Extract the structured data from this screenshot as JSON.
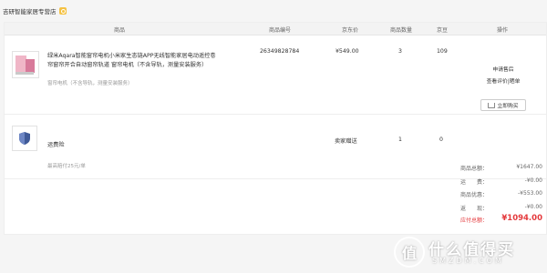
{
  "shop": {
    "name": "吉研智能家居专营店"
  },
  "table": {
    "headers": [
      "商品",
      "商品编号",
      "京东价",
      "商品数量",
      "京豆",
      "操作"
    ]
  },
  "product": {
    "title": "绿米Aqara智能窗帘电机小米家生态链APP无线智能家居电动遥控卷帘窗帘开合自动窗帘轨道 窗帘电机（不含导轨，测量安装服务）",
    "attr": "窗帘电机（不含导轨，测量安装服务）",
    "sku": "26349828784",
    "price": "¥549.00",
    "qty": "3",
    "beans": "109",
    "ops": {
      "apply_aftersale": "申请售后",
      "review": "查看评价|晒单",
      "repurchase": "立即购买"
    }
  },
  "service": {
    "name": "运费险",
    "price_label": "卖家赠送",
    "qty": "1",
    "beans": "0",
    "desc": "最高赔付25元/单"
  },
  "summary": [
    {
      "label": "商品总额：",
      "value": "¥1647.00"
    },
    {
      "label": "运　　费：",
      "value": "-¥0.00"
    },
    {
      "label": "商品优惠：",
      "value": "-¥553.00"
    },
    {
      "label": "返　　现：",
      "value": "-¥0.00"
    },
    {
      "label": "应付总额：",
      "value": "¥1094.00"
    }
  ],
  "watermark": {
    "brand": "值 什么值得买",
    "domain": "SMZDM.COM"
  },
  "colors": {
    "accent_red": "#e4393c",
    "header_bg": "#f3f3f3"
  }
}
